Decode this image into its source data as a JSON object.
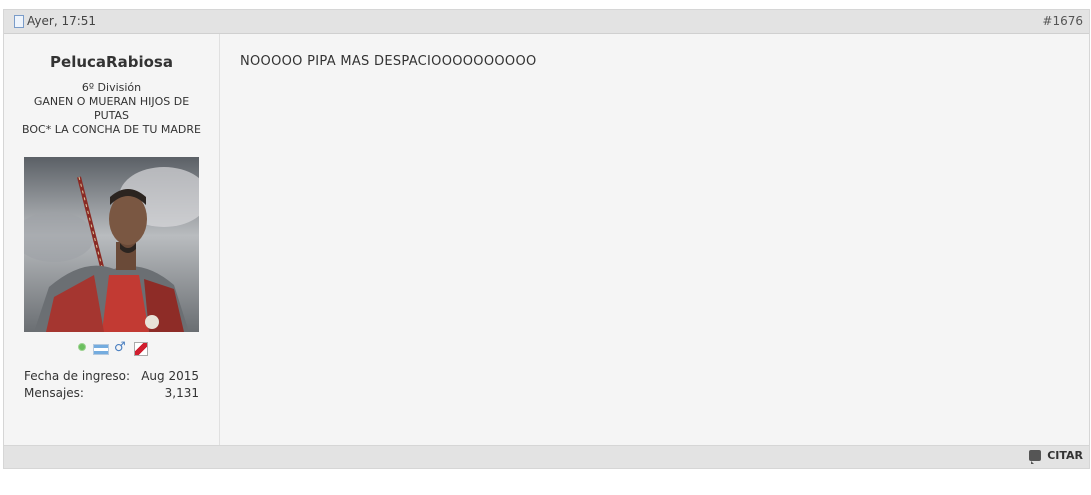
{
  "post": {
    "date": "Ayer, 17:51",
    "number": "#1676",
    "user": {
      "name": "PelucaRabiosa",
      "rank": "6º División",
      "title_line1": "GANEN O MUERAN HIJOS DE PUTAS",
      "title_line2": "BOC* LA CONCHA DE TU MADRE",
      "stats": [
        {
          "label": "Fecha de ingreso:",
          "value": "Aug 2015"
        },
        {
          "label": "Mensajes:",
          "value": "3,131"
        }
      ],
      "icons": [
        "online-status-icon",
        "argentina-flag-icon",
        "male-gender-icon",
        "team-badge-icon"
      ]
    },
    "message": "NOOOOO PIPA MAS DESPACIOOOOOOOOOO",
    "quote_label": "CITAR"
  }
}
